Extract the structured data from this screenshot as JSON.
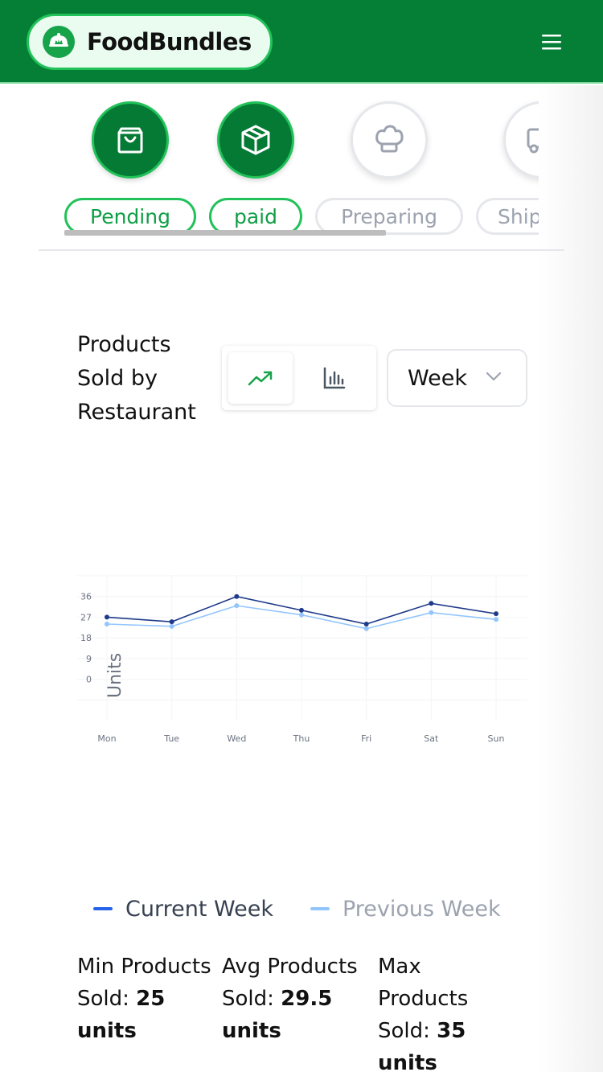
{
  "header": {
    "brand_name": "FoodBundles",
    "logo_icon": "food-cover-icon",
    "menu_icon": "hamburger-menu-icon",
    "background_color": "#047f35"
  },
  "order_steps": [
    {
      "label": "Pending",
      "icon": "shopping-bag-icon",
      "active": true
    },
    {
      "label": "paid",
      "icon": "package-box-icon",
      "active": true
    },
    {
      "label": "Preparing",
      "icon": "chef-hat-icon",
      "active": false
    },
    {
      "label": "Ship",
      "icon": "delivery-truck-icon",
      "active": false
    }
  ],
  "chart_panel": {
    "title": "Products Sold by Restaurant",
    "view_toggle": [
      {
        "icon": "trending-up-icon",
        "selected": true
      },
      {
        "icon": "bar-chart-icon",
        "selected": false
      }
    ],
    "period_value": "Week"
  },
  "chart_data": {
    "type": "line",
    "categories": [
      "Mon",
      "Tue",
      "Wed",
      "Thu",
      "Fri",
      "Sat",
      "Sun"
    ],
    "series": [
      {
        "name": "Current Week",
        "values": [
          27,
          25,
          36,
          30,
          24,
          33,
          28.5
        ],
        "color": "#1e3a8a"
      },
      {
        "name": "Previous Week",
        "values": [
          24,
          23,
          32,
          28,
          22,
          29,
          26
        ],
        "color": "#93c5fd"
      }
    ],
    "ylabel": "Units",
    "yticks": [
      0,
      9,
      18,
      27,
      36
    ],
    "ylim": [
      -18,
      45
    ],
    "grid": true,
    "legend": "bottom"
  },
  "legend": [
    {
      "label": "Current Week",
      "color": "#2563eb",
      "text_color": "#374151"
    },
    {
      "label": "Previous Week",
      "color": "#93c5fd",
      "text_color": "#9ca3af"
    }
  ],
  "stats": {
    "min": {
      "label": "Min Products Sold:",
      "value": "25 units"
    },
    "avg": {
      "label": "Avg Products Sold:",
      "value": "29.5 units"
    },
    "max": {
      "label": "Max Products Sold:",
      "value": "35 units"
    }
  }
}
